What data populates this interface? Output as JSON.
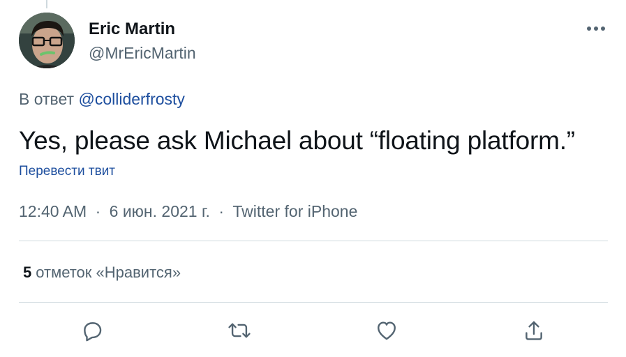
{
  "tweet": {
    "author": {
      "display_name": "Eric Martin",
      "handle": "@MrEricMartin",
      "avatar_icon": "profile-photo"
    },
    "reply_prefix": "В ответ",
    "reply_mention": "@colliderfrosty",
    "text": "Yes, please ask Michael about “floating platform.”",
    "translate_label": "Перевести твит",
    "time": "12:40 AM",
    "separator": "·",
    "date": "6 июн. 2021 г.",
    "source": "Twitter for iPhone",
    "likes": {
      "count": "5",
      "label": "отметок «Нравится»"
    }
  },
  "actions": {
    "reply_icon": "reply-icon",
    "retweet_icon": "retweet-icon",
    "like_icon": "like-icon",
    "share_icon": "share-icon"
  },
  "colors": {
    "text": "#0f1419",
    "secondary": "#536471",
    "link": "#1d4e9e",
    "divider": "#cfd9de"
  }
}
